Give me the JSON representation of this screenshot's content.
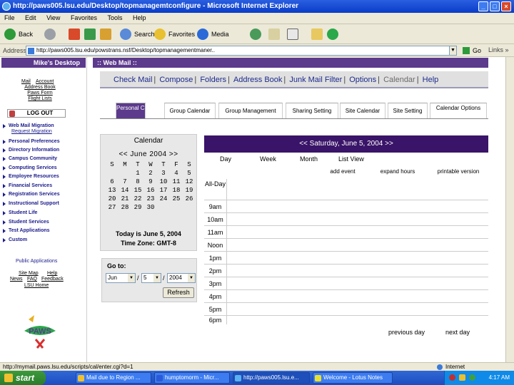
{
  "window": {
    "title": "http://paws005.lsu.edu/Desktop/topmanagemtconfigure - Microsoft Internet Explorer",
    "btn_min": "_",
    "btn_max": "□",
    "btn_close": "×"
  },
  "menu": [
    "File",
    "Edit",
    "View",
    "Favorites",
    "Tools",
    "Help"
  ],
  "toolbar": {
    "back": "Back",
    "search": "Search",
    "favorites": "Favorites",
    "media": "Media"
  },
  "address": {
    "label": "Address",
    "url": "http://paws005.lsu.edu/powstrans.nsf/Desktop/topmanagementmaner..",
    "go": "Go",
    "links": "Links »"
  },
  "leftnav": {
    "header": "Mike's Desktop",
    "links": [
      "Mail",
      "Account",
      "Address Book",
      "Paws Form",
      "Flight Lists"
    ],
    "logout": "LOG OUT",
    "items": [
      "Web Mail Migration",
      "Personal Preferences",
      "Directory Information",
      "Campus Community",
      "Computing Services",
      "Employee Resources",
      "Financial Services",
      "Registration Services",
      "Instructional Support",
      "Student Life",
      "Student Services",
      "Test Applications",
      "Custom"
    ],
    "sub_item": "Request Migration",
    "public_apps": "Public Applications",
    "footer_links": [
      "Site Map",
      "Help",
      "News",
      "FAQ",
      "Feedback",
      "LSU Home"
    ],
    "logo": "PAWS"
  },
  "webmail": {
    "header": ":: Web Mail ::",
    "tabs": [
      "Check Mail",
      "Compose",
      "Folders",
      "Address Book",
      "Junk Mail Filter",
      "Options",
      "Calendar",
      "Help"
    ]
  },
  "caltabs": [
    "Personal Calendar",
    "Group Calendar",
    "Group Management",
    "Sharing Setting",
    "Site Calendar",
    "Site Setting",
    "Calendar Options"
  ],
  "minical": {
    "title": "Calendar",
    "nav": "<< June 2004 >>",
    "days": [
      "S",
      "M",
      "T",
      "W",
      "T",
      "F",
      "S"
    ],
    "weeks": [
      [
        "",
        "",
        "1",
        "2",
        "3",
        "4",
        "5"
      ],
      [
        "6",
        "7",
        "8",
        "9",
        "10",
        "11",
        "12"
      ],
      [
        "13",
        "14",
        "15",
        "16",
        "17",
        "18",
        "19"
      ],
      [
        "20",
        "21",
        "22",
        "23",
        "24",
        "25",
        "26"
      ],
      [
        "27",
        "28",
        "29",
        "30",
        "",
        "",
        ""
      ]
    ],
    "today": "Today is June 5, 2004",
    "timezone": "Time Zone: GMT-8"
  },
  "goto": {
    "label": "Go to:",
    "month": "Jun",
    "day": "5",
    "year": "2004",
    "refresh": "Refresh"
  },
  "dayview": {
    "header": "<<  Saturday, June 5, 2004  >>",
    "views": [
      "Day",
      "Week",
      "Month",
      "List View"
    ],
    "actions": [
      "add event",
      "expand hours",
      "printable version"
    ],
    "hours": [
      "All-Day",
      "9am",
      "10am",
      "11am",
      "Noon",
      "1pm",
      "2pm",
      "3pm",
      "4pm",
      "5pm",
      "6pm"
    ],
    "prev": "previous day",
    "next": "next day"
  },
  "status": {
    "url": "http://mymail.paws.lsu.edu/scripts/cal/enter.cgi?d=1",
    "zone": "Internet"
  },
  "taskbar": {
    "start": "start",
    "tasks": [
      "Mail due to Region ...",
      "humptomorm - Micr...",
      "http://paws005.lsu.e...",
      "Welcome - Lotus Notes"
    ],
    "clock": "4:17 AM"
  }
}
